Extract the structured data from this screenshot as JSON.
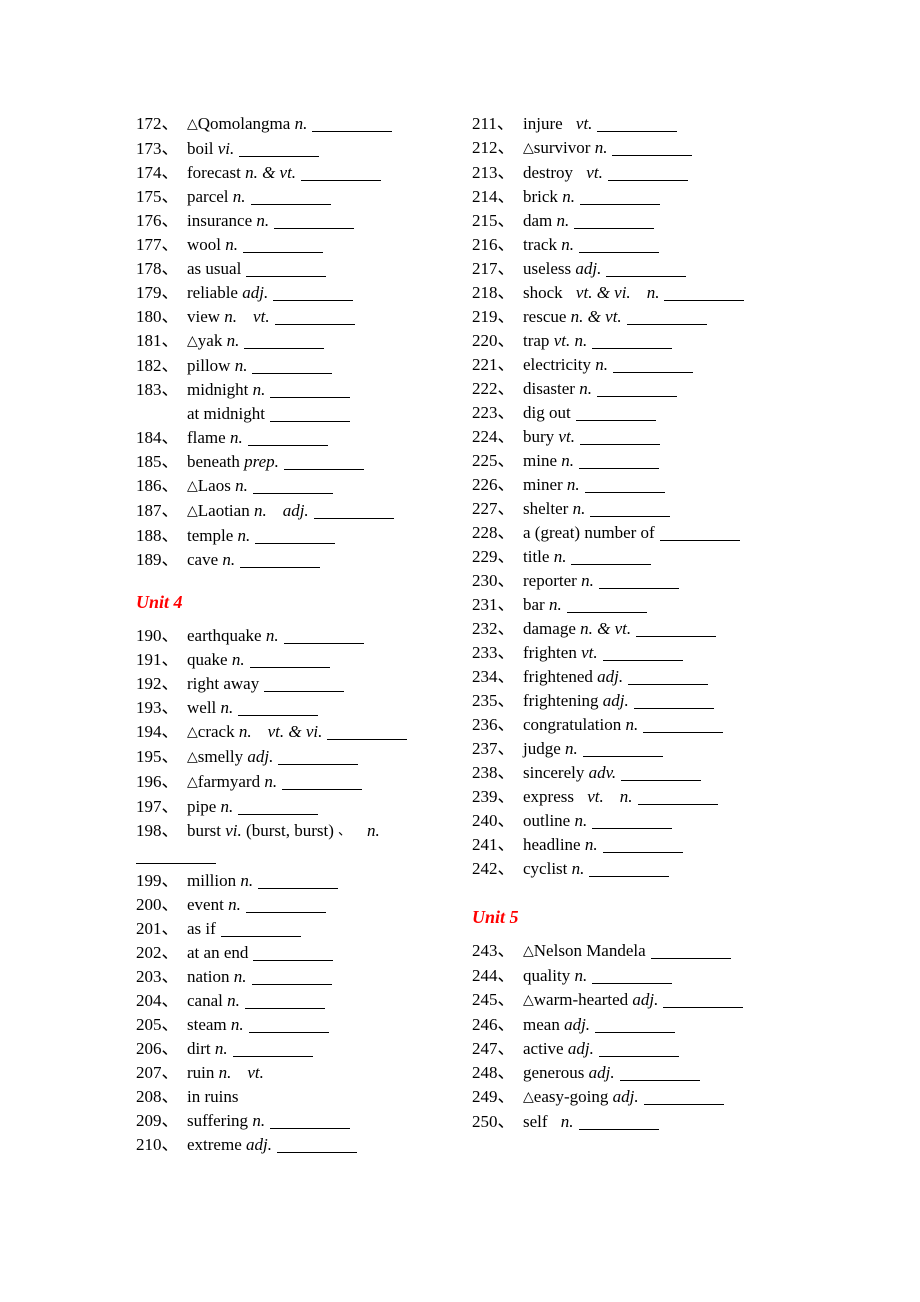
{
  "document": {
    "type": "vocabulary-worksheet",
    "separator": "、",
    "triangle_marker": "△",
    "accent_color": "#ff0000",
    "background_color": "#ffffff",
    "text_color": "#000000"
  },
  "left_column": {
    "entries_before_unit4": [
      {
        "num": "172",
        "tri": true,
        "word": "Qomolangma",
        "pos": "n.",
        "blank": true
      },
      {
        "num": "173",
        "tri": false,
        "word": "boil",
        "pos": "vi.",
        "blank": true
      },
      {
        "num": "174",
        "tri": false,
        "word": "forecast",
        "pos": "n. & vt.",
        "blank": true
      },
      {
        "num": "175",
        "tri": false,
        "word": "parcel",
        "pos": "n.",
        "blank": true
      },
      {
        "num": "176",
        "tri": false,
        "word": "insurance",
        "pos": "n.",
        "blank": true
      },
      {
        "num": "177",
        "tri": false,
        "word": "wool",
        "pos": "n.",
        "blank": true
      },
      {
        "num": "178",
        "tri": false,
        "word": "as usual",
        "pos": "",
        "blank": true
      },
      {
        "num": "179",
        "tri": false,
        "word": "reliable",
        "pos": "adj.",
        "blank": true
      },
      {
        "num": "180",
        "tri": false,
        "word": "view",
        "pos": "n.",
        "pos2": "vt.",
        "blank": true
      },
      {
        "num": "181",
        "tri": true,
        "word": "yak",
        "pos": "n.",
        "blank": true
      },
      {
        "num": "182",
        "tri": false,
        "word": "pillow",
        "pos": "n.",
        "blank": true
      },
      {
        "num": "183",
        "tri": false,
        "word": "midnight",
        "pos": "n.",
        "blank": true,
        "sub": "at midnight",
        "sub_blank": true
      },
      {
        "num": "184",
        "tri": false,
        "word": "flame",
        "pos": "n.",
        "blank": true
      },
      {
        "num": "185",
        "tri": false,
        "word": "beneath",
        "pos": "prep.",
        "blank": true
      },
      {
        "num": "186",
        "tri": true,
        "word": "Laos",
        "pos": "n.",
        "blank": true
      },
      {
        "num": "187",
        "tri": true,
        "word": "Laotian",
        "pos": "n.",
        "pos2": "adj.",
        "blank": true
      },
      {
        "num": "188",
        "tri": false,
        "word": "temple",
        "pos": "n.",
        "blank": true
      },
      {
        "num": "189",
        "tri": false,
        "word": "cave",
        "pos": "n.",
        "blank": true
      }
    ],
    "unit4_heading": "Unit 4",
    "entries_unit4": [
      {
        "num": "190",
        "tri": false,
        "word": "earthquake",
        "pos": "n.",
        "blank": true
      },
      {
        "num": "191",
        "tri": false,
        "word": "quake",
        "pos": "n.",
        "blank": true
      },
      {
        "num": "192",
        "tri": false,
        "word": "right away",
        "pos": "",
        "blank": true
      },
      {
        "num": "193",
        "tri": false,
        "word": "well",
        "pos": "n.",
        "blank": true
      },
      {
        "num": "194",
        "tri": true,
        "word": "crack",
        "pos": "n.",
        "pos2": "vt. & vi.",
        "blank": true
      },
      {
        "num": "195",
        "tri": true,
        "word": "smelly",
        "pos": "adj.",
        "blank": true
      },
      {
        "num": "196",
        "tri": true,
        "word": "farmyard",
        "pos": "n.",
        "blank": true
      },
      {
        "num": "197",
        "tri": false,
        "word": "pipe",
        "pos": "n.",
        "blank": true
      },
      {
        "num": "198",
        "tri": false,
        "word": "burst",
        "pos": "vi.",
        "extra": "(burst, burst)",
        "tail_sep": "、",
        "pos2": "n.",
        "blank": false,
        "wrap_blank": true
      },
      {
        "num": "199",
        "tri": false,
        "word": "million",
        "pos": "n.",
        "blank": true
      },
      {
        "num": "200",
        "tri": false,
        "word": "event",
        "pos": "n.",
        "blank": true
      },
      {
        "num": "201",
        "tri": false,
        "word": "as if",
        "pos": "",
        "blank": true
      },
      {
        "num": "202",
        "tri": false,
        "word": "at an end",
        "pos": "",
        "blank": true
      },
      {
        "num": "203",
        "tri": false,
        "word": "nation",
        "pos": "n.",
        "blank": true
      },
      {
        "num": "204",
        "tri": false,
        "word": "canal",
        "pos": "n.",
        "blank": true
      },
      {
        "num": "205",
        "tri": false,
        "word": "steam",
        "pos": "n.",
        "blank": true
      },
      {
        "num": "206",
        "tri": false,
        "word": "dirt",
        "pos": "n.",
        "blank": true
      },
      {
        "num": "207",
        "tri": false,
        "word": "ruin",
        "pos": "n.",
        "pos2": "vt.",
        "blank": false
      },
      {
        "num": "208",
        "tri": false,
        "word": "in ruins",
        "pos": "",
        "blank": false
      },
      {
        "num": "209",
        "tri": false,
        "word": "suffering",
        "pos": "n.",
        "blank": true
      },
      {
        "num": "210",
        "tri": false,
        "word": "extreme",
        "pos": "adj.",
        "blank": true
      }
    ]
  },
  "right_column": {
    "entries_unit4_cont": [
      {
        "num": "211",
        "tri": false,
        "word": "injure",
        "pos": "vt.",
        "blank": true,
        "space_before_pos": true
      },
      {
        "num": "212",
        "tri": true,
        "word": "survivor",
        "pos": "n.",
        "blank": true
      },
      {
        "num": "213",
        "tri": false,
        "word": "destroy",
        "pos": "vt.",
        "blank": true,
        "space_before_pos": true
      },
      {
        "num": "214",
        "tri": false,
        "word": "brick",
        "pos": "n.",
        "blank": true
      },
      {
        "num": "215",
        "tri": false,
        "word": "dam",
        "pos": "n.",
        "blank": true
      },
      {
        "num": "216",
        "tri": false,
        "word": "track",
        "pos": "n.",
        "blank": true
      },
      {
        "num": "217",
        "tri": false,
        "word": "useless",
        "pos": "adj.",
        "blank": true
      },
      {
        "num": "218",
        "tri": false,
        "word": "shock",
        "pos": "vt. & vi.",
        "pos2": "n.",
        "blank": true,
        "space_before_pos": true
      },
      {
        "num": "219",
        "tri": false,
        "word": "rescue",
        "pos": "n. & vt.",
        "blank": true
      },
      {
        "num": "220",
        "tri": false,
        "word": "trap",
        "pos": "vt. n.",
        "blank": true
      },
      {
        "num": "221",
        "tri": false,
        "word": "electricity",
        "pos": "n.",
        "blank": true
      },
      {
        "num": "222",
        "tri": false,
        "word": "disaster",
        "pos": "n.",
        "blank": true
      },
      {
        "num": "223",
        "tri": false,
        "word": "dig out",
        "pos": "",
        "blank": true
      },
      {
        "num": "224",
        "tri": false,
        "word": "bury",
        "pos": "vt.",
        "blank": true
      },
      {
        "num": "225",
        "tri": false,
        "word": "mine",
        "pos": "n.",
        "blank": true
      },
      {
        "num": "226",
        "tri": false,
        "word": "miner",
        "pos": "n.",
        "blank": true
      },
      {
        "num": "227",
        "tri": false,
        "word": "shelter",
        "pos": "n.",
        "blank": true
      },
      {
        "num": "228",
        "tri": false,
        "word": "a (great) number of",
        "pos": "",
        "blank": true
      },
      {
        "num": "229",
        "tri": false,
        "word": "title",
        "pos": "n.",
        "blank": true
      },
      {
        "num": "230",
        "tri": false,
        "word": "reporter",
        "pos": "n.",
        "blank": true
      },
      {
        "num": "231",
        "tri": false,
        "word": "bar",
        "pos": "n.",
        "blank": true
      },
      {
        "num": "232",
        "tri": false,
        "word": "damage",
        "pos": "n. & vt.",
        "blank": true
      },
      {
        "num": "233",
        "tri": false,
        "word": "frighten",
        "pos": "vt.",
        "blank": true
      },
      {
        "num": "234",
        "tri": false,
        "word": "frightened",
        "pos": "adj.",
        "blank": true
      },
      {
        "num": "235",
        "tri": false,
        "word": "frightening",
        "pos": "adj.",
        "blank": true
      },
      {
        "num": "236",
        "tri": false,
        "word": "congratulation",
        "pos": "n.",
        "blank": true
      },
      {
        "num": "237",
        "tri": false,
        "word": "judge",
        "pos": "n.",
        "blank": true
      },
      {
        "num": "238",
        "tri": false,
        "word": "sincerely",
        "pos": "adv.",
        "blank": true
      },
      {
        "num": "239",
        "tri": false,
        "word": "express",
        "pos": "vt.",
        "pos2": "n.",
        "blank": true,
        "space_before_pos": true
      },
      {
        "num": "240",
        "tri": false,
        "word": "outline",
        "pos": "n.",
        "blank": true
      },
      {
        "num": "241",
        "tri": false,
        "word": "headline",
        "pos": "n.",
        "blank": true
      },
      {
        "num": "242",
        "tri": false,
        "word": "cyclist",
        "pos": "n.",
        "blank": true
      }
    ],
    "unit5_heading": "Unit 5",
    "entries_unit5": [
      {
        "num": "243",
        "tri": true,
        "word": "Nelson Mandela",
        "pos": "",
        "blank": true
      },
      {
        "num": "244",
        "tri": false,
        "word": "quality",
        "pos": "n.",
        "blank": true
      },
      {
        "num": "245",
        "tri": true,
        "word": "warm-hearted",
        "pos": "adj.",
        "blank": true
      },
      {
        "num": "246",
        "tri": false,
        "word": "mean",
        "pos": "adj.",
        "blank": true
      },
      {
        "num": "247",
        "tri": false,
        "word": "active",
        "pos": "adj.",
        "blank": true
      },
      {
        "num": "248",
        "tri": false,
        "word": "generous",
        "pos": "adj.",
        "blank": true
      },
      {
        "num": "249",
        "tri": true,
        "word": "easy-going",
        "pos": "adj.",
        "blank": true
      },
      {
        "num": "250",
        "tri": false,
        "word": "self",
        "pos": "n.",
        "blank": true,
        "space_before_pos": true
      }
    ]
  }
}
